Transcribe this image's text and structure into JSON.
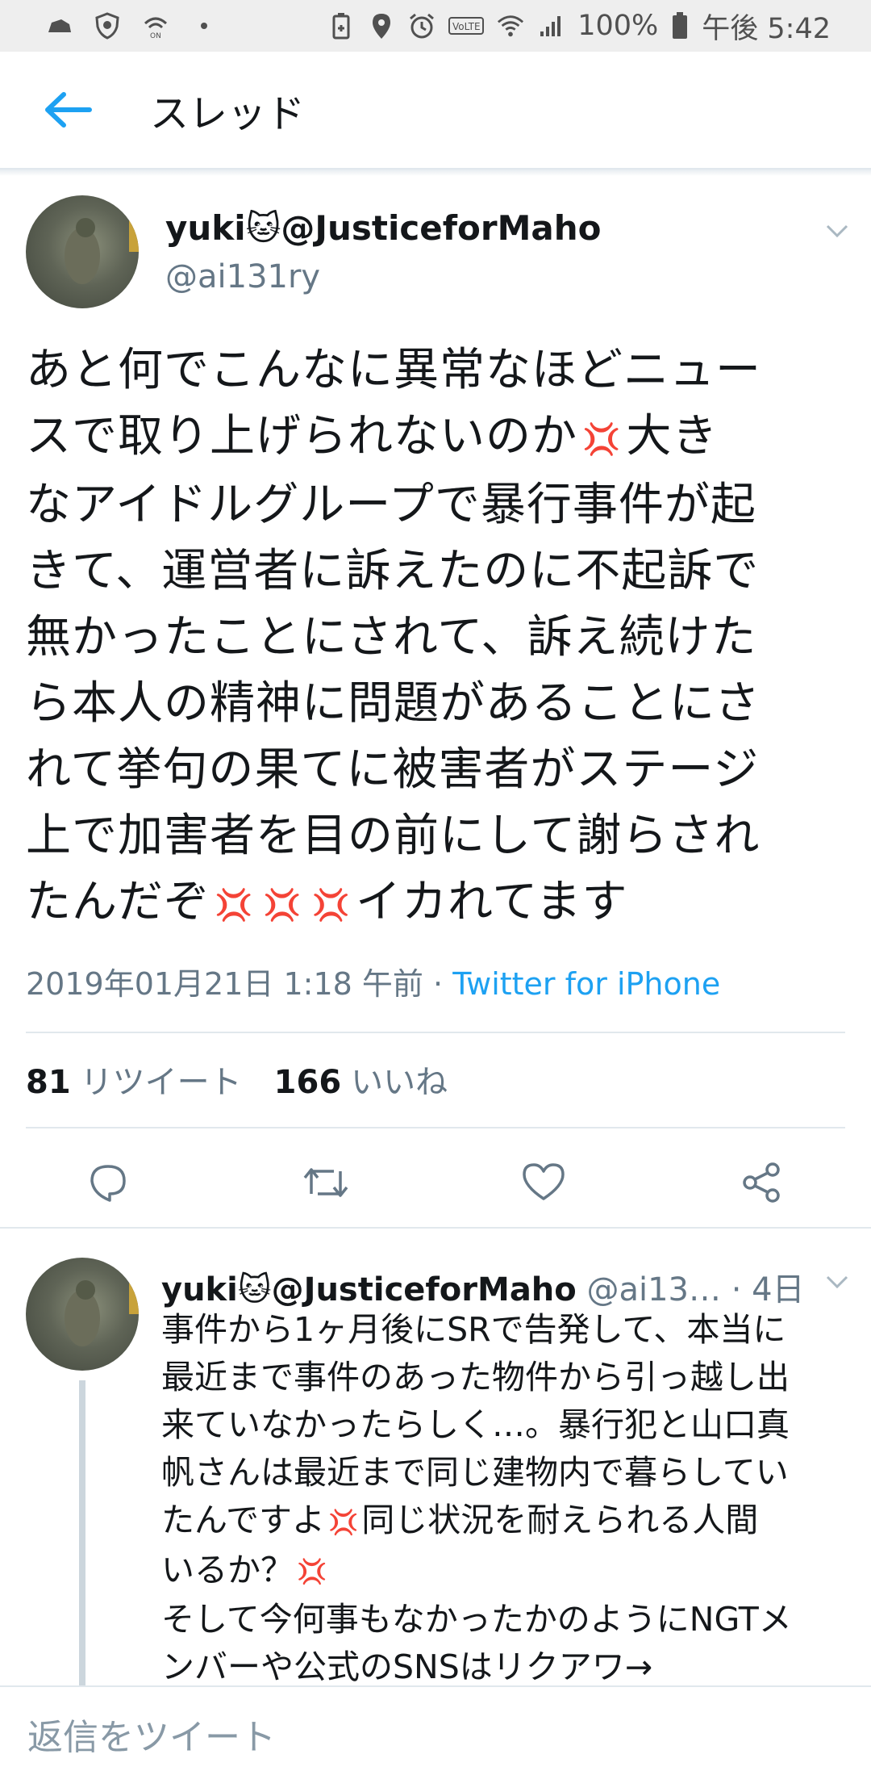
{
  "status_bar": {
    "battery_percent": "100%",
    "time": "午後 5:42",
    "icons_left": [
      "cloud-icon",
      "shield-icon",
      "wifi-calling-icon",
      "dot-icon"
    ],
    "icons_right": [
      "battery-saver-icon",
      "location-icon",
      "alarm-icon",
      "volte-icon",
      "wifi-icon",
      "signal-icon",
      "battery-icon"
    ]
  },
  "header": {
    "title": "スレッド",
    "back_icon": "arrow-left-icon",
    "accent_color": "#1da1f2"
  },
  "main_tweet": {
    "author_name": "yuki🐱@JusticeforMaho",
    "author_handle": "@ai131ry",
    "text_lines": [
      "あと何でこんなに異常なほどニュー",
      "スで取り上げられないのか",
      "大き",
      "なアイドルグループで暴行事件が起",
      "きて、運営者に訴えたのに不起訴で",
      "無かったことにされて、訴え続けた",
      "ら本人の精神に問題があることにさ",
      "れて挙句の果てに被害者がステージ",
      "上で加害者を目の前にして謝らされ",
      "たんだぞ",
      "イカれてます"
    ],
    "emoji": "💢",
    "timestamp": "2019年01月21日 1:18 午前",
    "meta_separator": "·",
    "source": "Twitter for iPhone",
    "retweet_count": "81",
    "retweet_label": "リツイート",
    "like_count": "166",
    "like_label": "いいね"
  },
  "actions": [
    "reply-icon",
    "retweet-icon",
    "like-icon",
    "share-icon"
  ],
  "reply_tweet": {
    "author_name": "yuki🐱@JusticeforMaho",
    "author_handle": "@ai13…",
    "time_ago": "· 4日",
    "text_lines": [
      "事件から1ヶ月後にSRで告発して、本当に",
      "最近まで事件のあった物件から引っ越し出",
      "来ていなかったらしく…。暴行犯と山口真",
      "帆さんは最近まで同じ建物内で暮らしてい",
      "たんですよ",
      "同じ状況を耐えられる人間",
      "いるか？",
      "そして今何事もなかったかのようにNGTメ",
      "ンバーや公式のSNSはリクアワ→"
    ]
  },
  "compose": {
    "placeholder": "返信をツイート"
  }
}
